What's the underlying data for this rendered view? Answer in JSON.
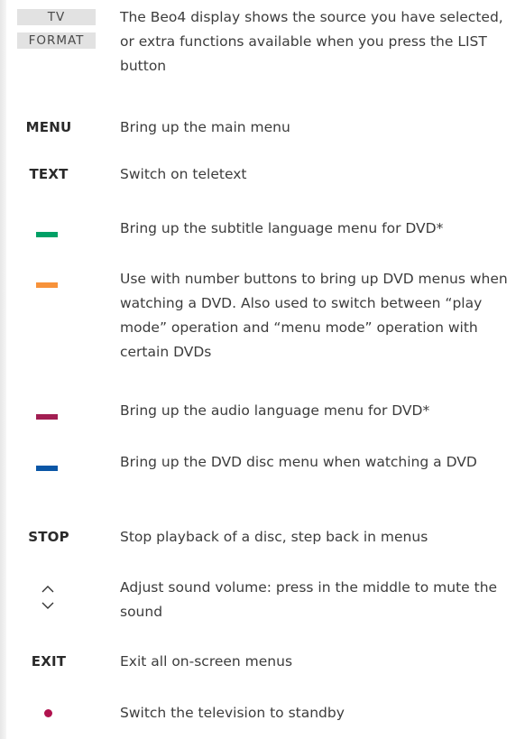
{
  "display": {
    "labels": [
      "TV",
      "FORMAT"
    ],
    "description": "The Beo4 display shows the source you have selected, or extra functions available when you press the LIST button"
  },
  "items": [
    {
      "key": "MENU",
      "description": "Bring up the main menu"
    },
    {
      "key": "TEXT",
      "description": "Switch on teletext"
    },
    {
      "key_icon": "green-button-icon",
      "color": "#00a066",
      "description": "Bring up the subtitle language menu for DVD*"
    },
    {
      "key_icon": "yellow-button-icon",
      "color": "#f7923a",
      "description": "Use with number buttons to bring up DVD menus when watching a DVD. Also used to switch between “play mode” operation and “menu mode” operation with certain DVDs"
    },
    {
      "key_icon": "red-button-icon",
      "color": "#a21e52",
      "description": "Bring up the audio language menu for DVD*"
    },
    {
      "key_icon": "blue-button-icon",
      "color": "#0a56a6",
      "description": "Bring up the DVD disc menu when watching a DVD"
    },
    {
      "key": "STOP",
      "description": "Stop playback of a disc, step back in menus"
    },
    {
      "key_icon": "volume-up-down-icon",
      "description": "Adjust sound volume: press in the middle to mute the sound"
    },
    {
      "key": "EXIT",
      "description": "Exit all on-screen menus"
    },
    {
      "key_icon": "standby-icon",
      "color": "#b0124e",
      "description": "Switch the television to standby"
    }
  ]
}
